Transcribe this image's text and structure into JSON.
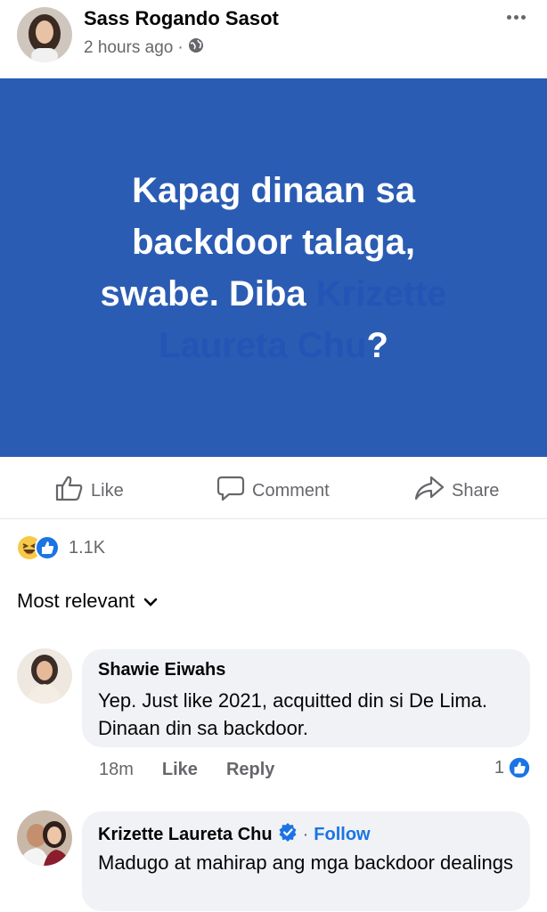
{
  "post": {
    "author_name": "Sass Rogando Sasot",
    "time": "2 hours ago",
    "meta_separator": "·",
    "privacy_icon": "globe-icon",
    "more_icon": "more-horizontal-icon",
    "text_before_mention": "Kapag dinaan sa backdoor talaga, swabe. Diba ",
    "mention": "Krizette Laureta Chu",
    "text_after_mention": "?",
    "background_color": "#2b5cb3"
  },
  "actions": {
    "like": "Like",
    "comment": "Comment",
    "share": "Share"
  },
  "reactions": {
    "icons": [
      "haha-icon",
      "like-reaction-icon"
    ],
    "count": "1.1K"
  },
  "sort": {
    "label": "Most relevant",
    "icon": "chevron-down-icon"
  },
  "comments": [
    {
      "name": "Shawie Eiwahs",
      "text": "Yep. Just like 2021, acquitted din si De Lima. Dinaan din sa backdoor.",
      "time": "18m",
      "like": "Like",
      "reply": "Reply",
      "reaction_count": "1"
    },
    {
      "name": "Krizette Laureta Chu",
      "verified_icon": "verified-badge-icon",
      "separator": "·",
      "follow": "Follow",
      "text": "Madugo at mahirap ang mga backdoor dealings"
    }
  ]
}
